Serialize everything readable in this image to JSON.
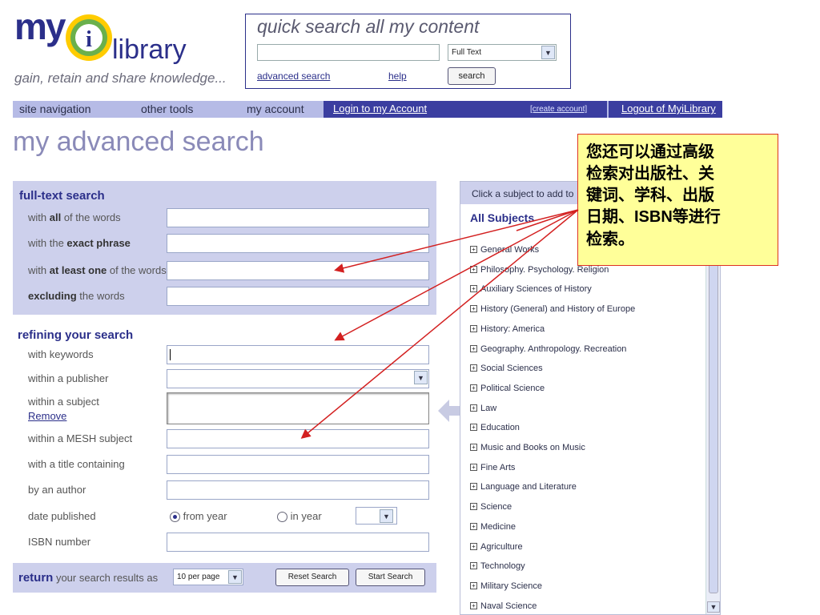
{
  "logo": {
    "my": "my",
    "library": "library",
    "i": "i",
    "tagline": "gain, retain and share knowledge..."
  },
  "quick_search": {
    "title": "quick search all my content",
    "input_value": "",
    "select_value": "Full Text",
    "advanced_link": "advanced search",
    "help_link": "help",
    "search_button": "search"
  },
  "nav": {
    "site_navigation": "site navigation",
    "other_tools": "other tools",
    "my_account": "my account",
    "login": "Login to my Account",
    "create_account": "[create account]",
    "logout": "Logout of MyiLibrary"
  },
  "page_title": "my advanced search",
  "full_text": {
    "title": "full-text search",
    "rows": [
      {
        "pre": "with ",
        "bold": "all",
        "post": " of the words",
        "value": ""
      },
      {
        "pre": "with the ",
        "bold": "exact phrase",
        "post": "",
        "value": ""
      },
      {
        "pre": "with ",
        "bold": "at least one",
        "post": " of the words",
        "value": ""
      },
      {
        "pre": "",
        "bold": "excluding",
        "post": " the words",
        "value": ""
      }
    ]
  },
  "refine": {
    "title": "refining your search",
    "keywords": "with keywords",
    "publisher": "within a publisher",
    "subject": "within a subject",
    "remove": "Remove",
    "mesh": "within a MESH subject",
    "title_containing": "with a title containing",
    "author": "by an author",
    "date_published": "date published",
    "from_year": "from year",
    "in_year": "in year",
    "isbn": "ISBN number"
  },
  "return": {
    "bold": "return",
    "rest": " your search results as",
    "per_page": "10 per page",
    "reset": "Reset Search",
    "start": "Start Search"
  },
  "subjects": {
    "hint": "Click a subject to add to",
    "all": "All Subjects",
    "items": [
      "General Works",
      "Philosophy. Psychology. Religion",
      "Auxiliary Sciences of History",
      "History (General) and History of Europe",
      "History: America",
      "Geography. Anthropology. Recreation",
      "Social Sciences",
      "Political Science",
      "Law",
      "Education",
      "Music and Books on Music",
      "Fine Arts",
      "Language and Literature",
      "Science",
      "Medicine",
      "Agriculture",
      "Technology",
      "Military Science",
      "Naval Science"
    ]
  },
  "callout": {
    "line1": "您还可以通过高级",
    "line2": "检索对出版社、关",
    "line3": "键词、学科、出版",
    "line4_pre": "日期、",
    "line4_bold": "ISBN",
    "line4_post": "等进行",
    "line5": "检索。"
  },
  "colors": {
    "brand": "#2b2f8a",
    "panel": "#cdd0ec",
    "nav_bar": "#b6bbe6",
    "callout_bg": "#ffff99",
    "arrow": "#d32020"
  }
}
